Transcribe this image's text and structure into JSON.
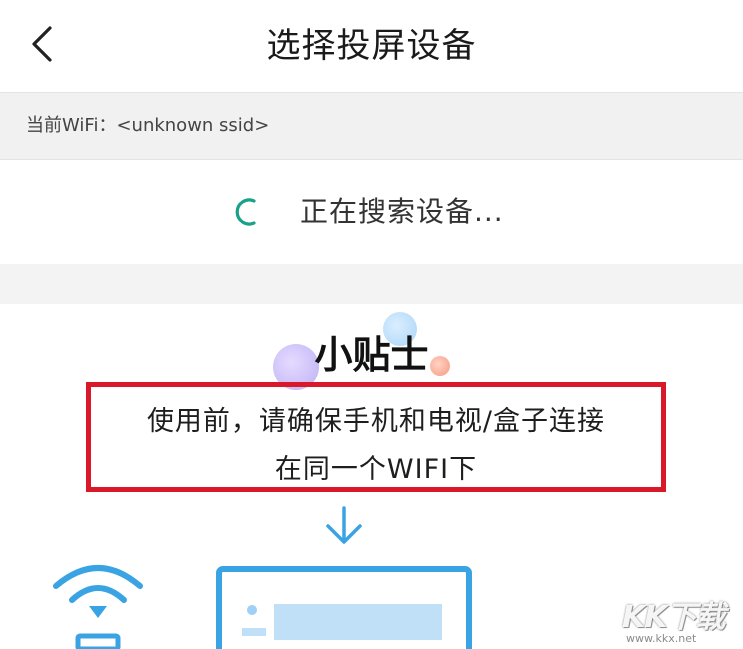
{
  "header": {
    "title": "选择投屏设备",
    "back_icon": "chevron-left-icon"
  },
  "wifi": {
    "label": "当前WiFi：<unknown ssid>"
  },
  "search": {
    "status_text": "正在搜索设备...",
    "spinner_icon": "loading-spinner-icon",
    "accent_color": "#1aa18a"
  },
  "tips": {
    "title": "小贴士",
    "line1": "使用前，请确保手机和电视/盒子连接",
    "line2": "在同一个WIFI下",
    "highlight_color": "#d9192a"
  },
  "illustration": {
    "arrow_icon": "arrow-down-icon",
    "wifi_icon": "wifi-icon",
    "tv_icon": "tv-screen-icon",
    "illustration_color": "#3aa3e3"
  },
  "watermark": {
    "brand": "KK下载",
    "url": "www.kkx.net"
  }
}
